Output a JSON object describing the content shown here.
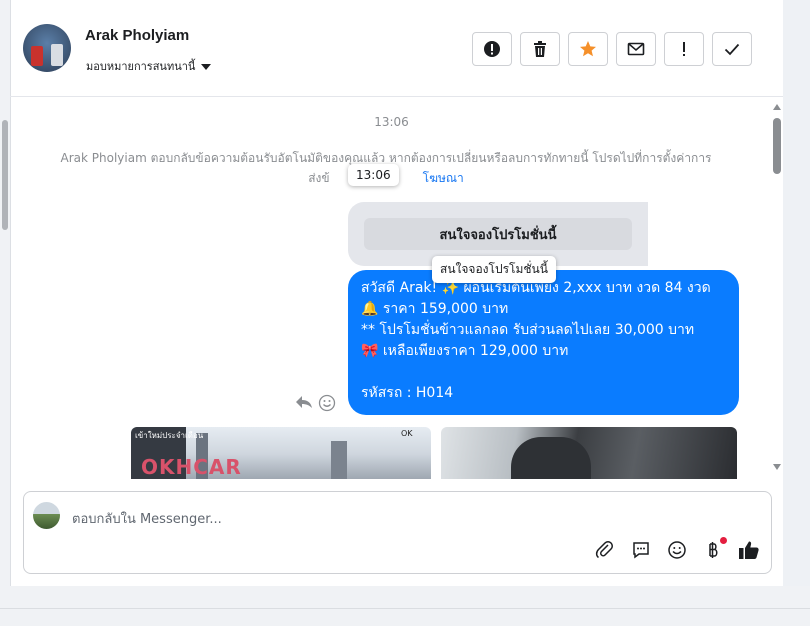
{
  "colors": {
    "accent": "#1877f2",
    "bubble": "#0a7cff",
    "star": "#f5902a",
    "badge": "#e41e3f"
  },
  "header": {
    "contact_name": "Arak Pholyiam",
    "assign_label": "มอบหมายการสนทนานี้",
    "actions": [
      {
        "name": "spam-button",
        "icon": "alert-circle-icon"
      },
      {
        "name": "delete-button",
        "icon": "trash-icon"
      },
      {
        "name": "star-button",
        "icon": "star-icon"
      },
      {
        "name": "mark-unread-button",
        "icon": "envelope-icon"
      },
      {
        "name": "follow-up-button",
        "icon": "exclamation-icon"
      },
      {
        "name": "mark-done-button",
        "icon": "check-icon"
      }
    ]
  },
  "thread": {
    "timestamp": "13:06",
    "system_message_line1": "Arak Pholyiam ตอบกลับข้อความต้อนรับอัตโนมัติของคุณแล้ว หากต้องการเปลี่ยนหรือลบการทักทายนี้ โปรดไปที่การตั้งค่าการ",
    "system_message_line2_prefix": "ส่งข้",
    "system_message_link": "โฆษณา",
    "timestamp_tooltip": "13:06",
    "quick_reply_label": "สนใจจองโปรโมชั่นนี้",
    "quick_reply_tooltip": "สนใจจองโปรโมชั่นนี้",
    "bubble_lines": [
      "สวัสดี Arak! ✨  ผ่อนเริ่มต้นเพียง 2,xxx บาท งวด 84 งวด",
      "🔔 ราคา 159,000 บาท",
      "** โปรโมชั่นข้าวแลกลด รับส่วนลดไปเลย 30,000 บาท",
      "🎀  เหลือเพียงราคา 129,000 บาท",
      "",
      " รหัสรถ : H014"
    ],
    "image1_caption": "เข้าใหม่ประจำเดือน",
    "image1_logo": "OKHCAR",
    "image1_watermark": "OK"
  },
  "composer": {
    "placeholder": "ตอบกลับใน Messenger...",
    "icons": [
      "paperclip-icon",
      "saved-reply-icon",
      "emoji-icon",
      "baht-payment-icon",
      "thumbs-up-icon"
    ]
  }
}
